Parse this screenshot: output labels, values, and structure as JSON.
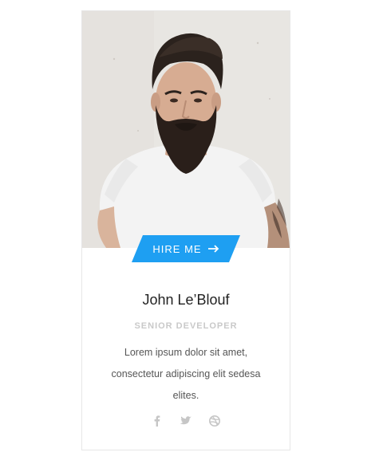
{
  "card": {
    "hire_label": "HIRE ME",
    "hire_icon": "arrow-right-icon",
    "name": "John Le’Blouf",
    "role": "SENIOR DEVELOPER",
    "bio": "Lorem ipsum dolor sit amet, consectetur adipiscing elit sedesa elites.",
    "socials": [
      "facebook-icon",
      "twitter-icon",
      "dribbble-icon"
    ]
  },
  "colors": {
    "accent": "#1e9ff2",
    "border": "#e6e6e6",
    "muted": "#c9c9c9",
    "text": "#555555",
    "heading": "#222222"
  }
}
